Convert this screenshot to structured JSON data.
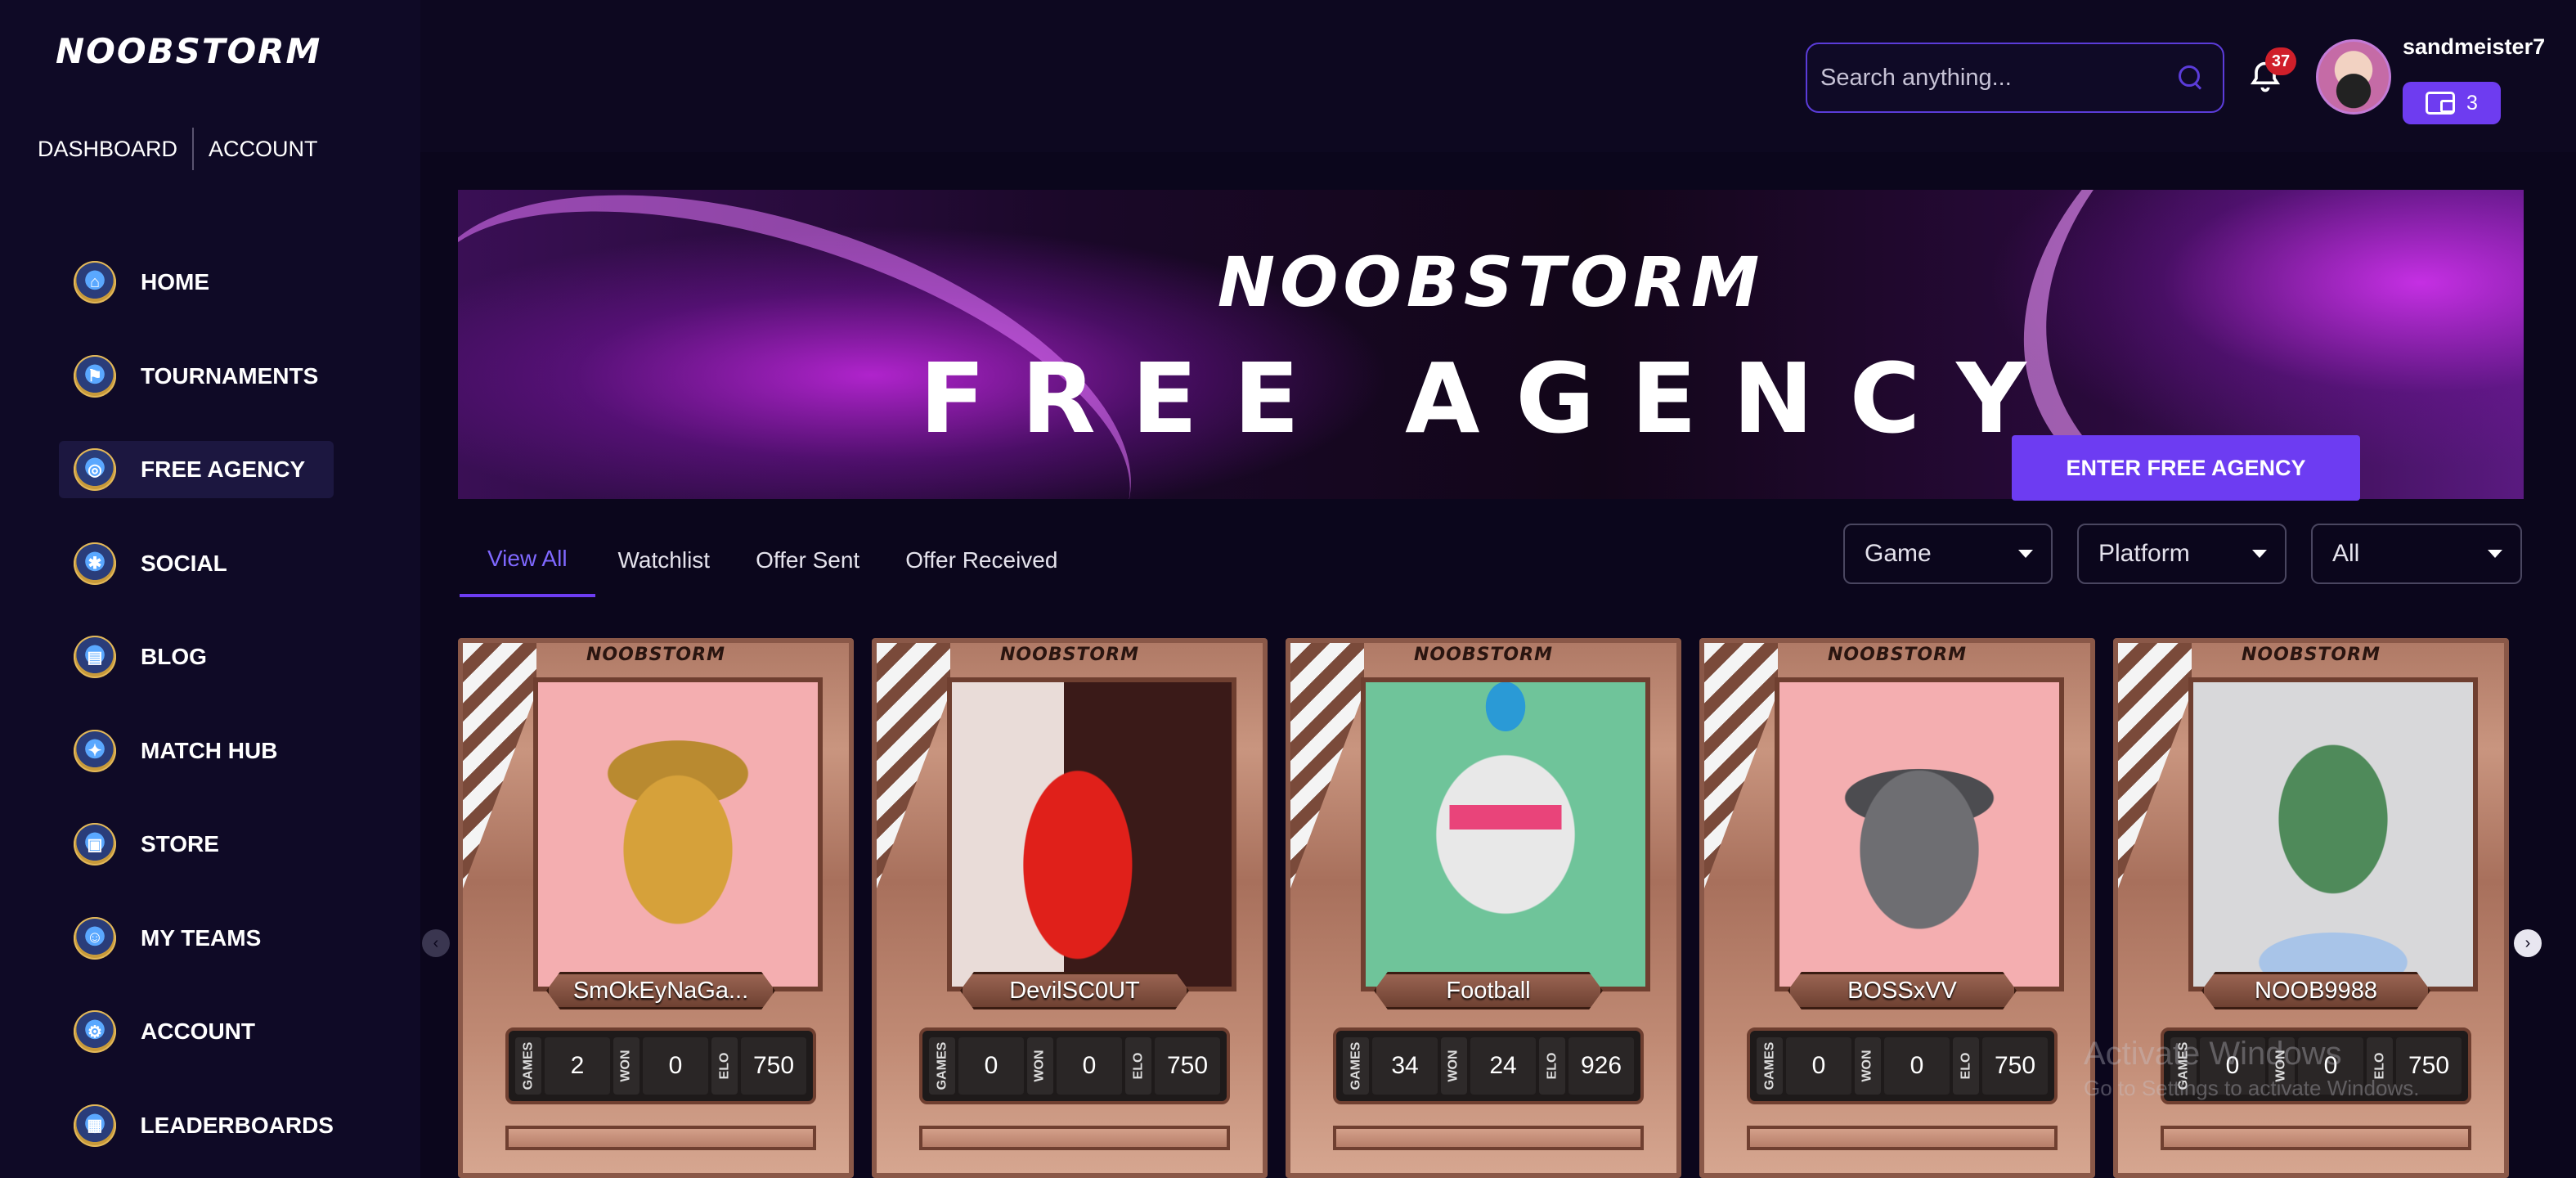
{
  "brand": {
    "logo_text": "NOOBSTORM"
  },
  "top_nav": {
    "dashboard": "DASHBOARD",
    "account": "ACCOUNT"
  },
  "sidebar": {
    "items": [
      {
        "label": "HOME",
        "icon": "home-icon"
      },
      {
        "label": "TOURNAMENTS",
        "icon": "flag-icon"
      },
      {
        "label": "FREE AGENCY",
        "icon": "agency-icon",
        "active": true
      },
      {
        "label": "SOCIAL",
        "icon": "social-icon"
      },
      {
        "label": "BLOG",
        "icon": "blog-icon"
      },
      {
        "label": "MATCH HUB",
        "icon": "match-hub-icon"
      },
      {
        "label": "STORE",
        "icon": "store-icon"
      },
      {
        "label": "MY TEAMS",
        "icon": "teams-icon"
      },
      {
        "label": "ACCOUNT",
        "icon": "account-icon"
      },
      {
        "label": "LEADERBOARDS",
        "icon": "leaderboard-icon"
      }
    ]
  },
  "header": {
    "search_placeholder": "Search anything...",
    "notification_count": "37",
    "username": "sandmeister7",
    "wallet_count": "3"
  },
  "banner": {
    "logo_text": "NOOBSTORM",
    "title": "FREE AGENCY",
    "cta_label": "ENTER FREE AGENCY"
  },
  "tabs": [
    {
      "label": "View All",
      "active": true
    },
    {
      "label": "Watchlist"
    },
    {
      "label": "Offer Sent"
    },
    {
      "label": "Offer Received"
    }
  ],
  "filters": {
    "game": "Game",
    "platform": "Platform",
    "status": "All"
  },
  "card_brand": "NOOBSTORM",
  "stat_labels": {
    "games": "GAMES",
    "won": "WON",
    "elo": "ELO"
  },
  "cards": [
    {
      "name": "SmOkEyNaGa...",
      "games": "2",
      "won": "0",
      "elo": "750",
      "portrait": "goat"
    },
    {
      "name": "DevilSC0UT",
      "games": "0",
      "won": "0",
      "elo": "750",
      "portrait": "red-suit"
    },
    {
      "name": "Football",
      "games": "34",
      "won": "24",
      "elo": "926",
      "portrait": "panda"
    },
    {
      "name": "BOSSxVV",
      "games": "0",
      "won": "0",
      "elo": "750",
      "portrait": "gray-goat"
    },
    {
      "name": "NOOB9988",
      "games": "0",
      "won": "0",
      "elo": "750",
      "portrait": "alien"
    }
  ],
  "watermark": {
    "line1": "Activate Windows",
    "line2": "Go to Settings to activate Windows."
  },
  "colors": {
    "accent": "#6d3cf2",
    "background": "#0b061c",
    "sidebar": "#0f0a26",
    "badge": "#d01f2a"
  }
}
